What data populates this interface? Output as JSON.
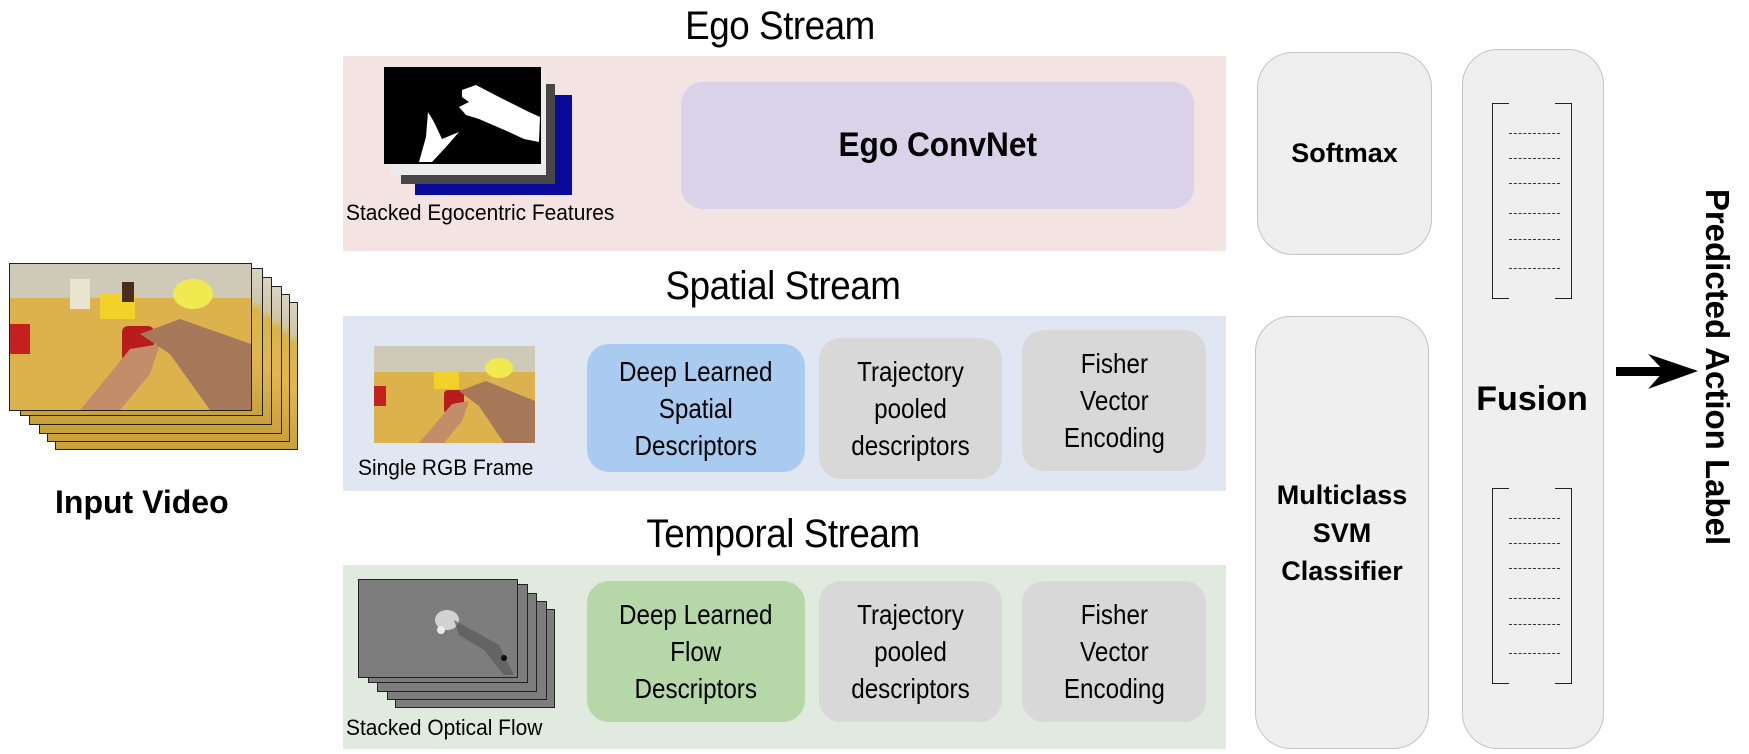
{
  "input": {
    "label": "Input Video",
    "frame_count": 6
  },
  "streams": {
    "ego": {
      "title": "Ego Stream",
      "input_caption": "Stacked Egocentric Features",
      "network_label": "Ego ConvNet",
      "color": "#f4e3e3"
    },
    "spatial": {
      "title": "Spatial Stream",
      "input_caption": "Single RGB Frame",
      "color": "#e1e7f2",
      "blocks": [
        {
          "label": "Deep Learned Spatial Descriptors",
          "lines": [
            "Deep Learned",
            "Spatial",
            "Descriptors"
          ],
          "color": "#a8cbef"
        },
        {
          "label": "Trajectory pooled descriptors",
          "lines": [
            "Trajectory",
            "pooled",
            "descriptors"
          ],
          "color": "#d8d8d8"
        },
        {
          "label": "Fisher Vector Encoding",
          "lines": [
            "Fisher",
            "Vector",
            "Encoding"
          ],
          "color": "#d8d8d8"
        }
      ]
    },
    "temporal": {
      "title": "Temporal Stream",
      "input_caption": "Stacked Optical Flow",
      "color": "#e1eadf",
      "blocks": [
        {
          "label": "Deep Learned Flow Descriptors",
          "lines": [
            "Deep Learned",
            "Flow",
            "Descriptors"
          ],
          "color": "#b6d8a8"
        },
        {
          "label": "Trajectory pooled descriptors",
          "lines": [
            "Trajectory",
            "pooled",
            "descriptors"
          ],
          "color": "#d8d8d8"
        },
        {
          "label": "Fisher Vector Encoding",
          "lines": [
            "Fisher",
            "Vector",
            "Encoding"
          ],
          "color": "#d8d8d8"
        }
      ]
    }
  },
  "classifiers": {
    "softmax": "Softmax",
    "svm_lines": [
      "Multiclass",
      "SVM",
      "Classifier"
    ]
  },
  "fusion": {
    "label": "Fusion",
    "vector_entries": 6
  },
  "output": {
    "label": "Predicted Action Label"
  }
}
